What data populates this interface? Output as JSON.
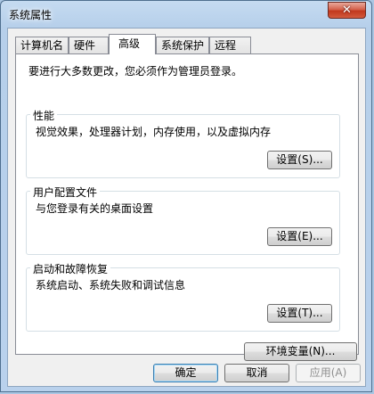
{
  "window": {
    "title": "系统属性",
    "close_glyph": "✕"
  },
  "tabs": [
    {
      "label": "计算机名"
    },
    {
      "label": "硬件"
    },
    {
      "label": "高级"
    },
    {
      "label": "系统保护"
    },
    {
      "label": "远程"
    }
  ],
  "active_tab": "高级",
  "advanced": {
    "notice": "要进行大多数更改，您必须作为管理员登录。",
    "groups": [
      {
        "title": "性能",
        "description": "视觉效果，处理器计划，内存使用，以及虚拟内存",
        "button": "设置(S)..."
      },
      {
        "title": "用户配置文件",
        "description": "与您登录有关的桌面设置",
        "button": "设置(E)..."
      },
      {
        "title": "启动和故障恢复",
        "description": "系统启动、系统失败和调试信息",
        "button": "设置(T)..."
      }
    ],
    "env_button": "环境变量(N)..."
  },
  "footer": {
    "ok": "确定",
    "cancel": "取消",
    "apply": "应用(A)"
  },
  "icons": {
    "close": "close-icon"
  }
}
